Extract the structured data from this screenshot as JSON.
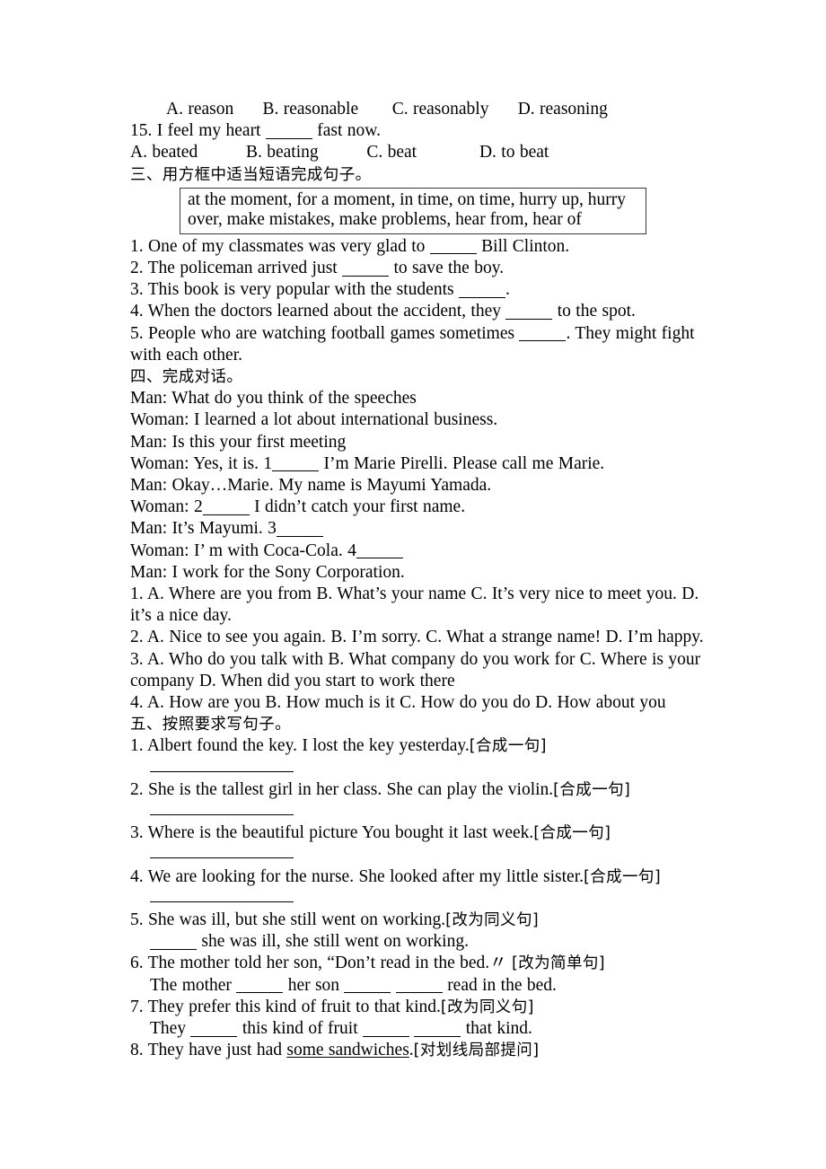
{
  "document": {
    "question_15": {
      "options_prev": "A. reason      B. reasonable       C. reasonably      D. reasoning",
      "stem_pre": "15. I feel my heart ",
      "stem_post": " fast now.",
      "options": "A. beated          B. beating          C. beat             D. to beat"
    },
    "section_three": {
      "heading": "三、用方框中适当短语完成句子。",
      "phrase_box": {
        "line1": "at the moment, for a moment, in time, on time, hurry up, hurry",
        "line2": "over, make mistakes, make problems, hear from, hear of"
      },
      "items": [
        {
          "pre": "1. One of my classmates was very glad to ",
          "post": " Bill Clinton."
        },
        {
          "pre": "2. The policeman arrived just ",
          "post": " to save the boy."
        },
        {
          "pre": "3. This book is very popular with the students ",
          "post": "."
        },
        {
          "pre": "4. When the doctors learned about the accident, they ",
          "post": " to the spot."
        },
        {
          "pre": "5. People who are watching football games sometimes ",
          "post": ". They might fight"
        },
        {
          "pre": "with each other.",
          "post": ""
        }
      ]
    },
    "section_four": {
      "heading": "四、完成对话。",
      "dialogue": [
        {
          "pre": "Man: What do you think of the speeches",
          "post": ""
        },
        {
          "pre": "Woman: I learned a lot about international business.",
          "post": ""
        },
        {
          "pre": "Man: Is this your first meeting",
          "post": ""
        },
        {
          "pre": "Woman: Yes, it is. 1",
          "post": " I’m Marie Pirelli. Please call me Marie."
        },
        {
          "pre": "Man: Okay…Marie. My name is Mayumi Yamada.",
          "post": ""
        },
        {
          "pre": "Woman: 2",
          "post": " I didn’t catch your first name."
        },
        {
          "pre": "Man: It’s Mayumi. 3",
          "post": ""
        },
        {
          "pre": "Woman: I’ m with Coca-Cola. 4",
          "post": ""
        },
        {
          "pre": "Man: I work for the Sony Corporation.",
          "post": ""
        }
      ],
      "choices": [
        "1. A. Where are you from B. What’s your name C. It’s very nice to meet you. D. it’s a nice day.",
        "2. A. Nice to see you again. B. I’m sorry. C. What a strange name! D. I’m happy.",
        "3. A. Who do you talk with B. What company do you work for C. Where is your company D. When did you start to work there",
        "4. A. How are you B. How much is it C. How do you do D. How about you"
      ]
    },
    "section_five": {
      "heading": "五、按照要求写句子。",
      "items": [
        {
          "text": "1. Albert found the key. I lost the key yesterday.",
          "tag": "[合成一句]"
        },
        {
          "text": "2. She is the tallest girl in her class. She can play the violin.",
          "tag": "[合成一句]"
        },
        {
          "text": "3. Where is the beautiful picture You bought it last week.",
          "tag": "[合成一句]"
        },
        {
          "text": "4. We are looking for the nurse. She looked after my little sister.",
          "tag": "[合成一句]"
        },
        {
          "text": "5. She was ill, but she still went on working.",
          "tag": "[改为同义句]"
        }
      ],
      "item5_answer_pre": "",
      "item5_answer_post": " she was ill, she still went on working.",
      "item6_text": "6. The mother told her son, “Don’t read in the bed.〃 ",
      "item6_tag": "[改为简单句]",
      "item6_answer_a": "The mother ",
      "item6_answer_b": " her son ",
      "item6_answer_c": " ",
      "item6_answer_d": " read in the bed.",
      "item7_text": "7. They prefer this kind of fruit to that kind.",
      "item7_tag": "[改为同义句]",
      "item7_answer_a": "They ",
      "item7_answer_b": " this kind of fruit ",
      "item7_answer_c": " ",
      "item7_answer_d": " that kind.",
      "item8_pre": "8. They have just had ",
      "item8_underlined": "some sandwiches",
      "item8_post": ".",
      "item8_tag": "[对划线局部提问]"
    }
  }
}
